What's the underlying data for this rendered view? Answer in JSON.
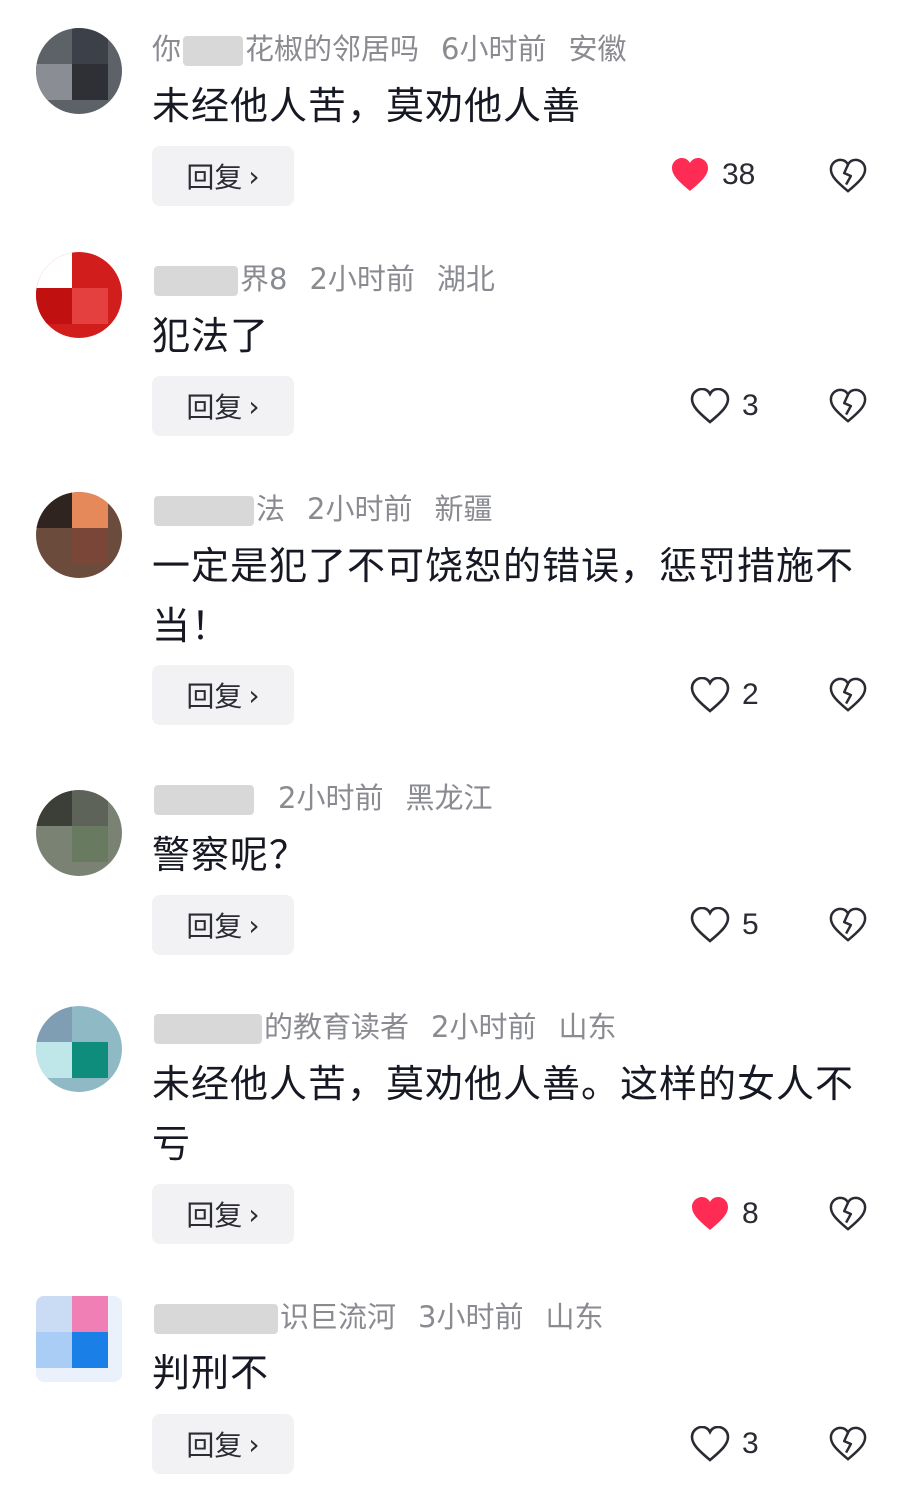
{
  "comments": [
    {
      "name_prefix": "你",
      "name_suffix": "花椒的邻居吗",
      "time": "6小时前",
      "location": "安徽",
      "text": "未经他人苦，莫劝他人善",
      "reply_label": "回复",
      "likes": "38",
      "liked": true
    },
    {
      "name_prefix": "",
      "name_suffix": "界8",
      "time": "2小时前",
      "location": "湖北",
      "text": "犯法了",
      "reply_label": "回复",
      "likes": "3",
      "liked": false
    },
    {
      "name_prefix": "",
      "name_suffix": "法",
      "time": "2小时前",
      "location": "新疆",
      "text": "一定是犯了不可饶恕的错误，惩罚措施不当！",
      "reply_label": "回复",
      "likes": "2",
      "liked": false
    },
    {
      "name_prefix": "",
      "name_suffix": "",
      "time": "2小时前",
      "location": "黑龙江",
      "text": "警察呢？",
      "reply_label": "回复",
      "likes": "5",
      "liked": false
    },
    {
      "name_prefix": "",
      "name_suffix": "的教育读者",
      "time": "2小时前",
      "location": "山东",
      "text": "未经他人苦，莫劝他人善。这样的女人不亏",
      "reply_label": "回复",
      "likes": "8",
      "liked": true
    },
    {
      "name_prefix": "",
      "name_suffix": "识巨流河",
      "time": "3小时前",
      "location": "山东",
      "text": "判刑不",
      "reply_label": "回复",
      "likes": "3",
      "liked": false
    }
  ],
  "icons": {
    "like": "heart-icon",
    "dislike": "broken-heart-icon",
    "reply_chevron": "chevron-right-icon"
  },
  "colors": {
    "liked_heart": "#fe2c55",
    "meta_text": "#8a8b91",
    "reply_bg": "#f2f2f4"
  }
}
